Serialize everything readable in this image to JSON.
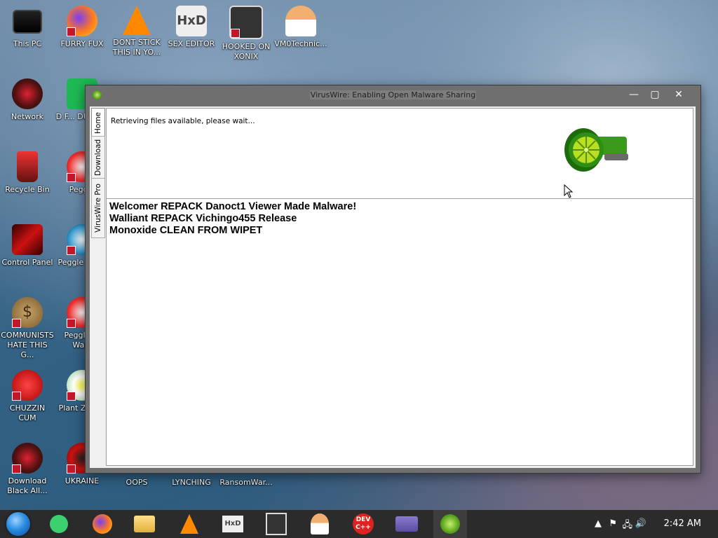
{
  "desktop": {
    "icons": [
      {
        "label": "This PC"
      },
      {
        "label": "FURRY FUX"
      },
      {
        "label": "DONT STICK THIS IN YO..."
      },
      {
        "label": "SEX EDITOR"
      },
      {
        "label": "HOOKED ON XONIX"
      },
      {
        "label": "VM0Technic..."
      },
      {
        "label": "Network"
      },
      {
        "label": "D F... DUMB..."
      },
      {
        "label": "Recycle Bin"
      },
      {
        "label": "Peggle"
      },
      {
        "label": "Control Panel"
      },
      {
        "label": "Peggle Del..."
      },
      {
        "label": "COMMUNISTS HATE THIS G..."
      },
      {
        "label": "Peggle of Wars"
      },
      {
        "label": "CHUZZIN CUM"
      },
      {
        "label": "Plant Zom..."
      },
      {
        "label": "Download Black All..."
      },
      {
        "label": "UKRAINE"
      },
      {
        "label": "OOPS"
      },
      {
        "label": "LYNCHING"
      },
      {
        "label": "RansomWar..."
      }
    ]
  },
  "window": {
    "title": "VirusWire: Enabling Open Malware Sharing",
    "minimize": "—",
    "maximize": "▢",
    "close": "✕",
    "tabs": [
      "Home",
      "Download",
      "VirusWire Pro"
    ],
    "status": "Retrieving files available, please wait...",
    "files": [
      "Welcomer REPACK Danoct1 Viewer Made Malware!",
      "Walliant REPACK Vichingo455 Release",
      "Monoxide CLEAN FROM WIPET"
    ]
  },
  "taskbar": {
    "devcpp_label": "DEV C++",
    "clock": "2:42 AM",
    "accent": "#3d3d3d"
  }
}
